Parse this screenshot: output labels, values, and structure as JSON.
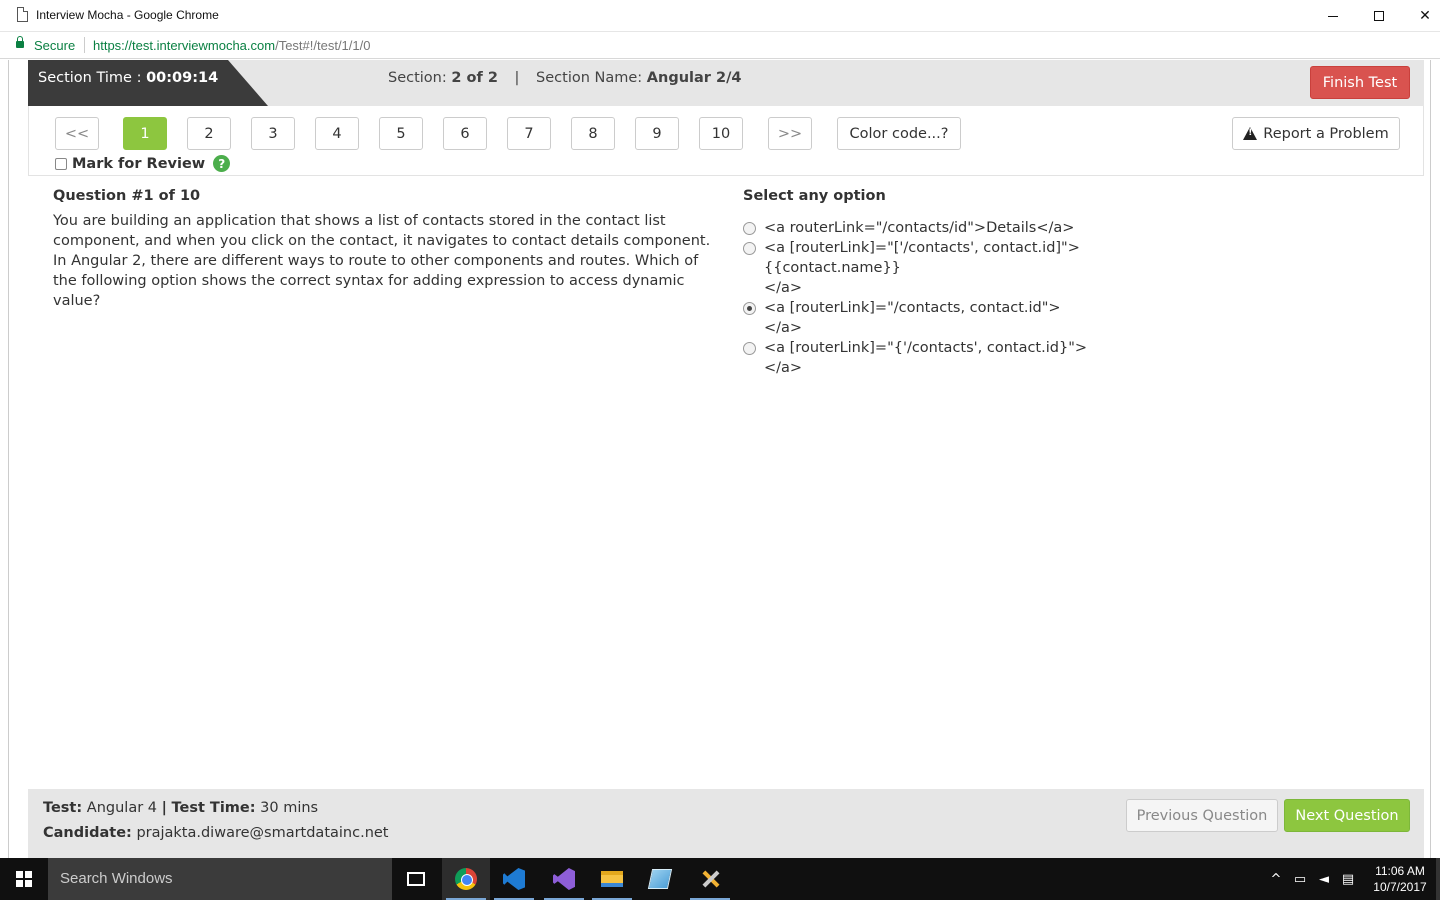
{
  "window": {
    "title": "Interview Mocha - Google Chrome",
    "minimize_icon": "minimize-icon",
    "maximize_icon": "maximize-icon",
    "close_glyph": "✕"
  },
  "address": {
    "secure_label": "Secure",
    "url_host": "https://test.interviewmocha.com",
    "url_path": "/Test#!/test/1/1/0"
  },
  "section": {
    "time_label": "Section Time :",
    "time_value": "00:09:14",
    "section_label": "Section:",
    "section_value": "2 of 2",
    "separator": "|",
    "name_label": "Section Name:",
    "name_value": "Angular 2/4",
    "finish_label": "Finish Test"
  },
  "question_nav": {
    "prev_label": "<<",
    "next_label": ">>",
    "numbers": [
      "1",
      "2",
      "3",
      "4",
      "5",
      "6",
      "7",
      "8",
      "9",
      "10"
    ],
    "active": "1",
    "color_code_label": "Color code...?",
    "report_label": "Report a Problem",
    "mark_review_label": "Mark for Review",
    "help_glyph": "?"
  },
  "question": {
    "title": "Question #1 of 10",
    "text": "You are building an application that shows a list of contacts stored in the contact list component, and when you click on the contact, it navigates to contact details component. In Angular 2, there are different ways to route to other components and routes. Which of the following option shows the correct syntax for adding expression to access dynamic value?"
  },
  "options": {
    "title": "Select any option",
    "items": [
      {
        "text": "<a routerLink=\"/contacts/id\">Details</a>",
        "selected": false
      },
      {
        "text": "<a [routerLink]=\"['/contacts', contact.id]\">\n{{contact.name}}\n</a>",
        "selected": false
      },
      {
        "text": "<a [routerLink]=\"/contacts, contact.id\">\n</a>",
        "selected": true
      },
      {
        "text": "<a [routerLink]=\"{'/contacts', contact.id}\">\n</a>",
        "selected": false
      }
    ]
  },
  "footer": {
    "test_label": "Test:",
    "test_value": "Angular 4",
    "pipe": "|",
    "time_label": "Test Time:",
    "time_value": "30 mins",
    "candidate_label": "Candidate:",
    "candidate_value": "prajakta.diware@smartdatainc.net",
    "prev_label": "Previous Question",
    "next_label": "Next Question"
  },
  "taskbar": {
    "search_placeholder": "Search Windows",
    "clock_time": "11:06 AM",
    "clock_date": "10/7/2017"
  },
  "colors": {
    "accent_green": "#8dc63f",
    "danger_red": "#d9534f",
    "section_dark": "#3b3b3b",
    "panel_gray": "#e6e6e6"
  }
}
